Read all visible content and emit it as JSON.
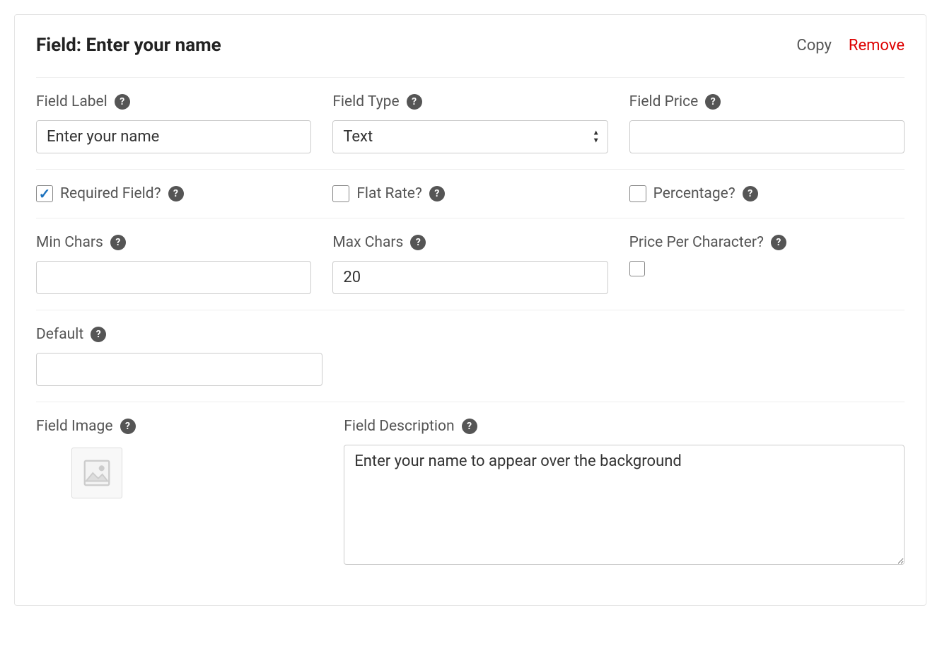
{
  "header": {
    "title_prefix": "Field: ",
    "title_value": "Enter your name",
    "copy_label": "Copy",
    "remove_label": "Remove"
  },
  "row1": {
    "field_label": {
      "label": "Field Label",
      "value": "Enter your name"
    },
    "field_type": {
      "label": "Field Type",
      "value": "Text"
    },
    "field_price": {
      "label": "Field Price",
      "value": ""
    }
  },
  "row2": {
    "required": {
      "label": "Required Field?",
      "checked": true
    },
    "flat_rate": {
      "label": "Flat Rate?",
      "checked": false
    },
    "percentage": {
      "label": "Percentage?",
      "checked": false
    }
  },
  "row3": {
    "min_chars": {
      "label": "Min Chars",
      "value": ""
    },
    "max_chars": {
      "label": "Max Chars",
      "value": "20"
    },
    "price_per_char": {
      "label": "Price Per Character?",
      "checked": false
    }
  },
  "row4": {
    "default": {
      "label": "Default",
      "value": ""
    }
  },
  "row5": {
    "field_image": {
      "label": "Field Image"
    },
    "field_description": {
      "label": "Field Description",
      "value": "Enter your name to appear over the background"
    }
  }
}
